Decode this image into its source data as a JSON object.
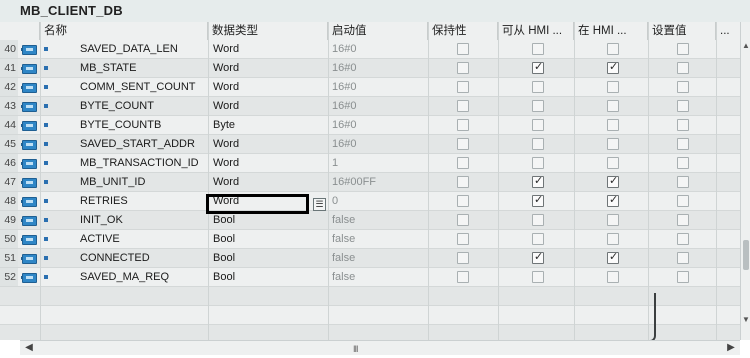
{
  "window": {
    "title": "MB_CLIENT_DB"
  },
  "columns": {
    "name": "名称",
    "type": "数据类型",
    "start": "启动值",
    "retain": "保持性",
    "hmi_access": "可从 HMI ...",
    "hmi_visible": "在 HMI ...",
    "setpoint": "设置值",
    "more": "..."
  },
  "rows": [
    {
      "idx": "40",
      "name": "SAVED_DATA_LEN",
      "type": "Word",
      "start": "16#0",
      "retain": false,
      "hmi_access": false,
      "hmi_visible": false,
      "setpoint": false
    },
    {
      "idx": "41",
      "name": "MB_STATE",
      "type": "Word",
      "start": "16#0",
      "retain": false,
      "hmi_access": true,
      "hmi_visible": true,
      "setpoint": false
    },
    {
      "idx": "42",
      "name": "COMM_SENT_COUNT",
      "type": "Word",
      "start": "16#0",
      "retain": false,
      "hmi_access": false,
      "hmi_visible": false,
      "setpoint": false
    },
    {
      "idx": "43",
      "name": "BYTE_COUNT",
      "type": "Word",
      "start": "16#0",
      "retain": false,
      "hmi_access": false,
      "hmi_visible": false,
      "setpoint": false
    },
    {
      "idx": "44",
      "name": "BYTE_COUNTB",
      "type": "Byte",
      "start": "16#0",
      "retain": false,
      "hmi_access": false,
      "hmi_visible": false,
      "setpoint": false
    },
    {
      "idx": "45",
      "name": "SAVED_START_ADDR",
      "type": "Word",
      "start": "16#0",
      "retain": false,
      "hmi_access": false,
      "hmi_visible": false,
      "setpoint": false
    },
    {
      "idx": "46",
      "name": "MB_TRANSACTION_ID",
      "type": "Word",
      "start": "1",
      "retain": false,
      "hmi_access": false,
      "hmi_visible": false,
      "setpoint": false
    },
    {
      "idx": "47",
      "name": "MB_UNIT_ID",
      "type": "Word",
      "start": "16#00FF",
      "retain": false,
      "hmi_access": true,
      "hmi_visible": true,
      "setpoint": false
    },
    {
      "idx": "48",
      "name": "RETRIES",
      "type": "Word",
      "start": "0",
      "retain": false,
      "hmi_access": true,
      "hmi_visible": true,
      "setpoint": false
    },
    {
      "idx": "49",
      "name": "INIT_OK",
      "type": "Bool",
      "start": "false",
      "retain": false,
      "hmi_access": false,
      "hmi_visible": false,
      "setpoint": false
    },
    {
      "idx": "50",
      "name": "ACTIVE",
      "type": "Bool",
      "start": "false",
      "retain": false,
      "hmi_access": false,
      "hmi_visible": false,
      "setpoint": false
    },
    {
      "idx": "51",
      "name": "CONNECTED",
      "type": "Bool",
      "start": "false",
      "retain": false,
      "hmi_access": true,
      "hmi_visible": true,
      "setpoint": false
    },
    {
      "idx": "52",
      "name": "SAVED_MA_REQ",
      "type": "Bool",
      "start": "false",
      "retain": false,
      "hmi_access": false,
      "hmi_visible": false,
      "setpoint": false
    }
  ],
  "scroll": {
    "grip": "III"
  },
  "icons": [
    "db-member-icon",
    "list-picker-icon",
    "checkbox-icon"
  ]
}
